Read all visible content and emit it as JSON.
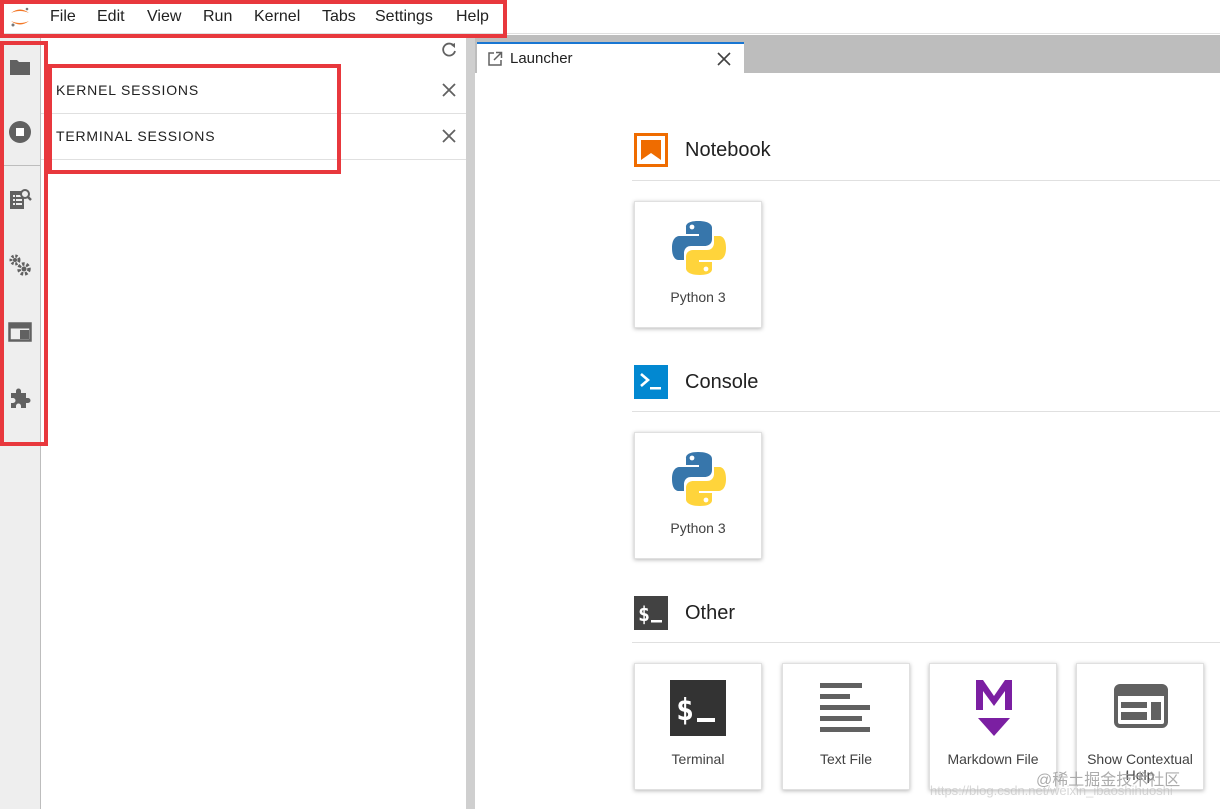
{
  "menubar": {
    "items": [
      "File",
      "Edit",
      "View",
      "Run",
      "Kernel",
      "Tabs",
      "Settings",
      "Help"
    ]
  },
  "sidebar": {
    "sections": [
      {
        "label": "KERNEL SESSIONS"
      },
      {
        "label": "TERMINAL SESSIONS"
      }
    ]
  },
  "tabs": [
    {
      "label": "Launcher",
      "active": true
    }
  ],
  "launcher": {
    "sections": [
      {
        "title": "Notebook",
        "icon": "notebook-icon",
        "cards": [
          {
            "label": "Python 3",
            "icon": "python-icon"
          }
        ]
      },
      {
        "title": "Console",
        "icon": "console-icon",
        "cards": [
          {
            "label": "Python 3",
            "icon": "python-icon"
          }
        ]
      },
      {
        "title": "Other",
        "icon": "other-icon",
        "cards": [
          {
            "label": "Terminal",
            "icon": "terminal-icon"
          },
          {
            "label": "Text File",
            "icon": "text-file-icon"
          },
          {
            "label": "Markdown File",
            "icon": "markdown-icon"
          },
          {
            "label": "Show Contextual Help",
            "icon": "contextual-help-icon"
          }
        ]
      }
    ]
  },
  "watermark": "@稀土掘金技术社区",
  "watermark_url": "https://blog.csdn.net/weixin_ibaoshihuoshi",
  "colors": {
    "accent": "#1976d2",
    "annotation_red": "#e8383d",
    "notebook_orange": "#ef6c00",
    "console_blue": "#0288d1",
    "markdown_purple": "#7b1fa2"
  }
}
